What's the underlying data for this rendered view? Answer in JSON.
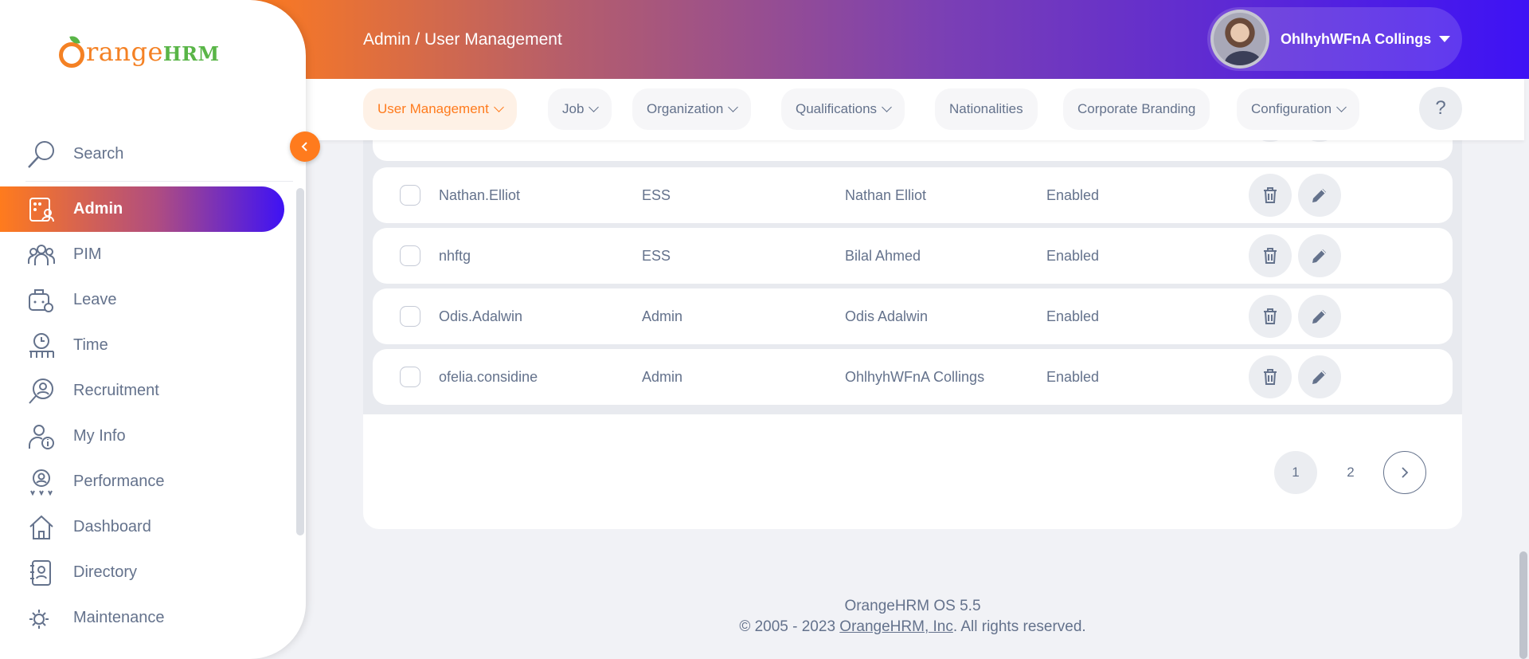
{
  "brand": {
    "logo_main": "range",
    "logo_suffix": "HRM"
  },
  "sidebar": {
    "search_label": "Search",
    "items": [
      {
        "label": "Admin",
        "icon": "admin-icon",
        "active": true
      },
      {
        "label": "PIM",
        "icon": "pim-icon"
      },
      {
        "label": "Leave",
        "icon": "leave-icon"
      },
      {
        "label": "Time",
        "icon": "time-icon"
      },
      {
        "label": "Recruitment",
        "icon": "recruitment-icon"
      },
      {
        "label": "My Info",
        "icon": "my-info-icon"
      },
      {
        "label": "Performance",
        "icon": "performance-icon"
      },
      {
        "label": "Dashboard",
        "icon": "dashboard-icon"
      },
      {
        "label": "Directory",
        "icon": "directory-icon"
      },
      {
        "label": "Maintenance",
        "icon": "maintenance-icon"
      }
    ]
  },
  "header": {
    "module": "Admin",
    "separator": " / ",
    "level": "User Management",
    "user_name": "OhlhyhWFnA Collings"
  },
  "subnav": {
    "tabs": [
      {
        "label": "User Management",
        "dropdown": true,
        "active": true
      },
      {
        "label": "Job",
        "dropdown": true
      },
      {
        "label": "Organization",
        "dropdown": true
      },
      {
        "label": "Qualifications",
        "dropdown": true
      },
      {
        "label": "Nationalities",
        "dropdown": false
      },
      {
        "label": "Corporate Branding",
        "dropdown": false
      },
      {
        "label": "Configuration",
        "dropdown": true
      }
    ],
    "help_label": "?"
  },
  "table": {
    "rows": [
      {
        "username": "Nathan.Elliot",
        "role": "ESS",
        "employee": "Nathan Elliot",
        "status": "Enabled"
      },
      {
        "username": "nhftg",
        "role": "ESS",
        "employee": "Bilal Ahmed",
        "status": "Enabled"
      },
      {
        "username": "Odis.Adalwin",
        "role": "Admin",
        "employee": "Odis Adalwin",
        "status": "Enabled"
      },
      {
        "username": "ofelia.considine",
        "role": "Admin",
        "employee": "OhlhyhWFnA Collings",
        "status": "Enabled"
      }
    ]
  },
  "pagination": {
    "pages": [
      "1",
      "2"
    ],
    "current": "1"
  },
  "footer": {
    "version": "OrangeHRM OS 5.5",
    "copyright_prefix": "© 2005 - 2023 ",
    "company_link": "OrangeHRM, Inc",
    "copyright_suffix": ". All rights reserved."
  },
  "colors": {
    "accent": "#ff7b1d",
    "gradient_end": "#3e12f5",
    "text": "#64728c"
  }
}
